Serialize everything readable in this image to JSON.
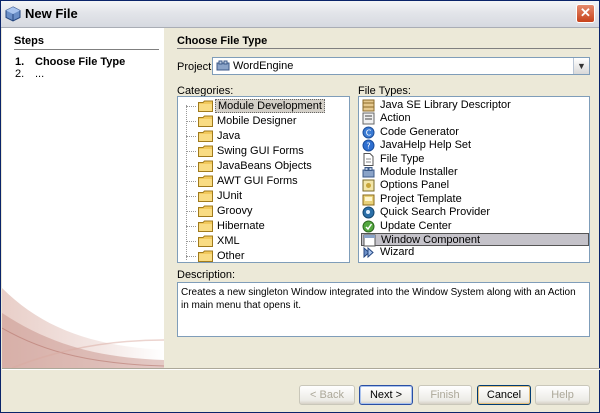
{
  "window": {
    "title": "New File",
    "close_glyph": "✕"
  },
  "steps": {
    "title": "Steps",
    "items": [
      {
        "num": "1.",
        "label": "Choose File Type",
        "bold": true
      },
      {
        "num": "2.",
        "label": "...",
        "bold": false
      }
    ]
  },
  "main": {
    "title": "Choose File Type",
    "project_label": "Project:",
    "project_value": "WordEngine",
    "categories_label": "Categories:",
    "file_types_label": "File Types:",
    "description_label": "Description:",
    "description_text": "Creates a new singleton Window integrated into the Window System along with an Action in main menu that opens it."
  },
  "categories": [
    "Module Development",
    "Mobile Designer",
    "Java",
    "Swing GUI Forms",
    "JavaBeans Objects",
    "AWT GUI Forms",
    "JUnit",
    "Groovy",
    "Hibernate",
    "XML",
    "Other"
  ],
  "selected_category": "Module Development",
  "file_types": [
    {
      "label": "Java SE Library Descriptor",
      "icon": "library-icon"
    },
    {
      "label": "Action",
      "icon": "action-icon"
    },
    {
      "label": "Code Generator",
      "icon": "code-generator-icon"
    },
    {
      "label": "JavaHelp Help Set",
      "icon": "help-icon"
    },
    {
      "label": "File Type",
      "icon": "file-type-icon"
    },
    {
      "label": "Module Installer",
      "icon": "module-installer-icon"
    },
    {
      "label": "Options Panel",
      "icon": "options-panel-icon"
    },
    {
      "label": "Project Template",
      "icon": "project-template-icon"
    },
    {
      "label": "Quick Search Provider",
      "icon": "quick-search-icon"
    },
    {
      "label": "Update Center",
      "icon": "update-center-icon"
    },
    {
      "label": "Window Component",
      "icon": "window-component-icon"
    },
    {
      "label": "Wizard",
      "icon": "wizard-icon"
    }
  ],
  "selected_file_type": "Window Component",
  "buttons": {
    "back": "< Back",
    "next": "Next >",
    "finish": "Finish",
    "cancel": "Cancel",
    "help": "Help"
  },
  "colors": {
    "folder": "#f2c95c",
    "accent": "#0a246a"
  }
}
